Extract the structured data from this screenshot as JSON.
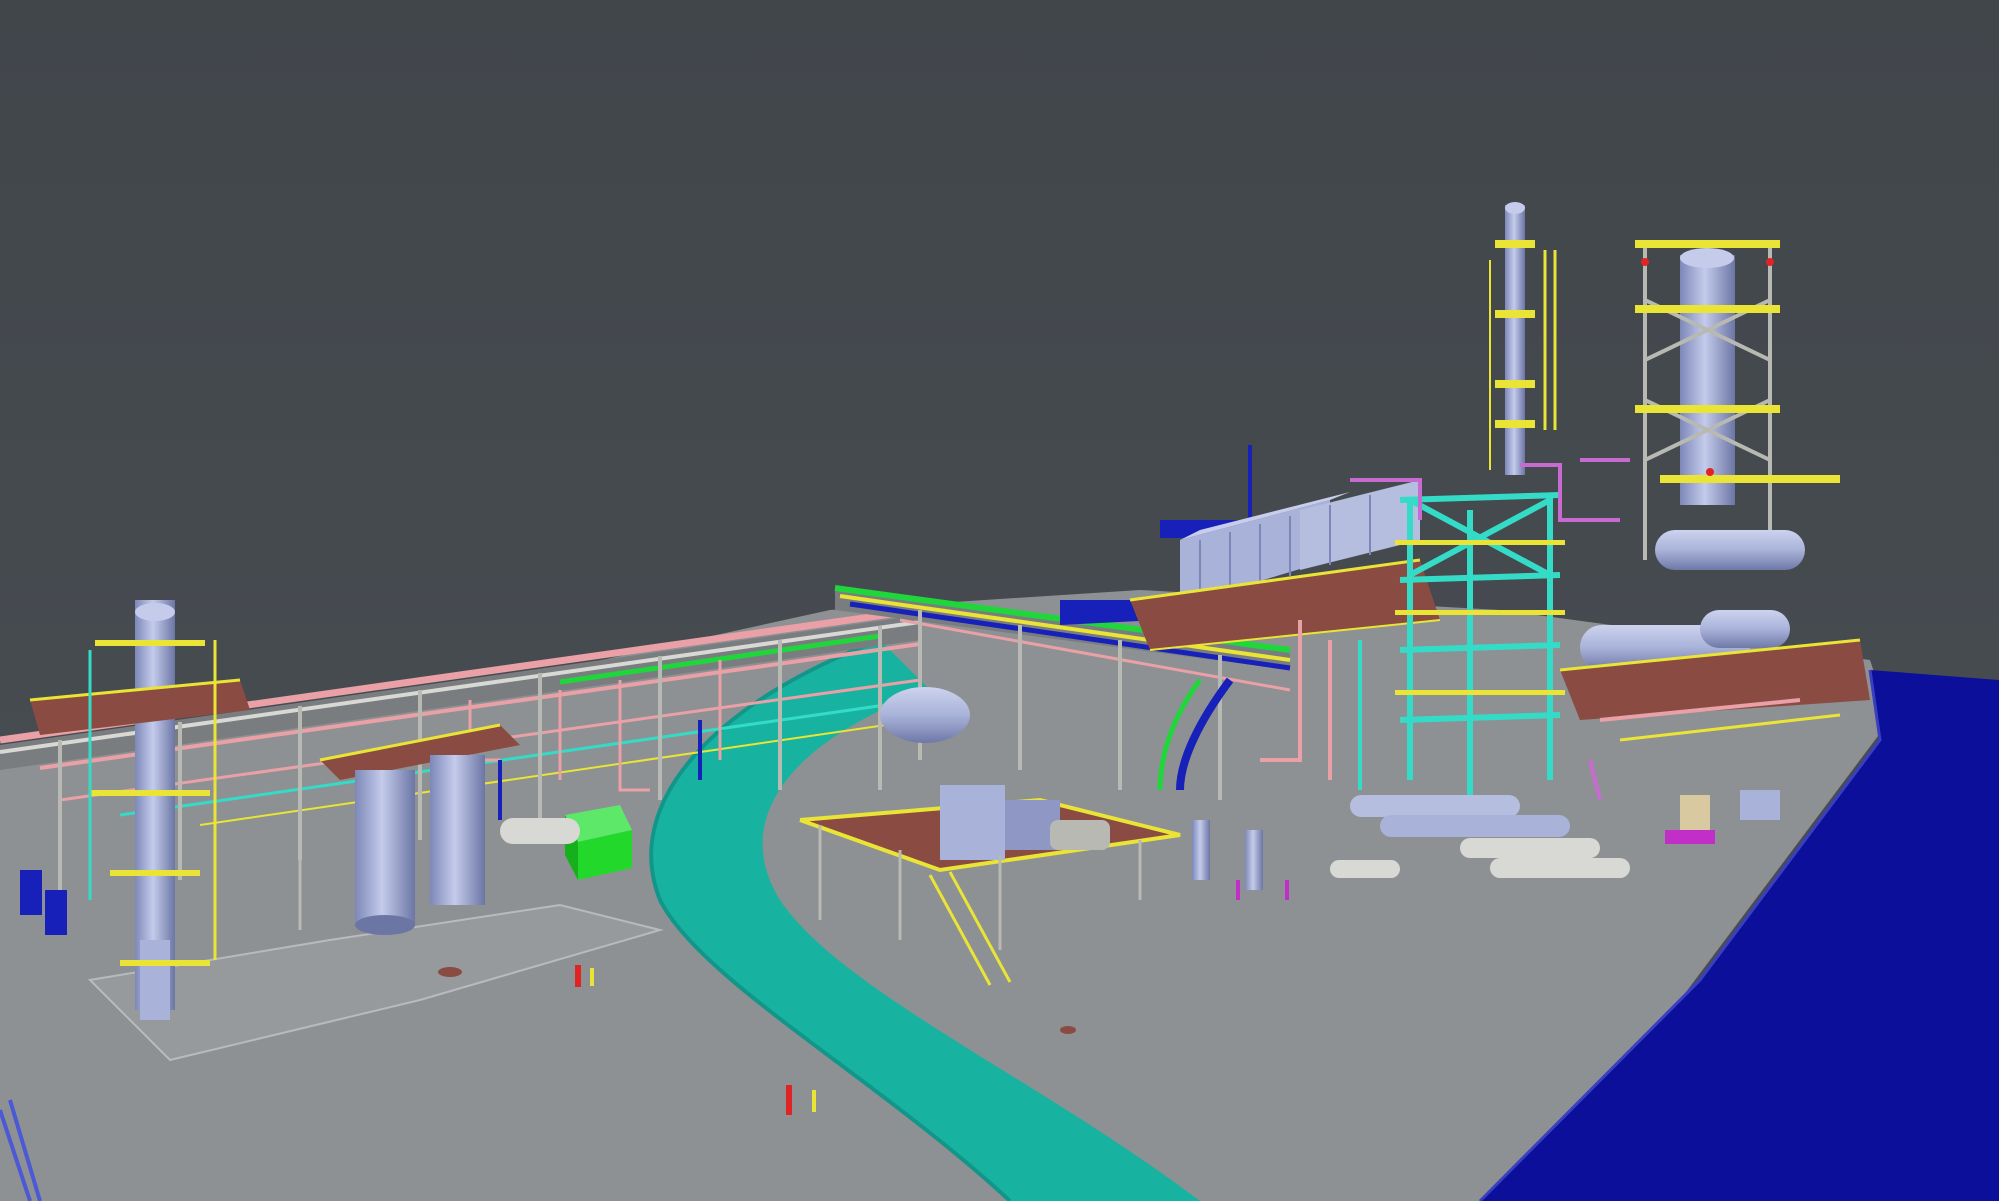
{
  "view": {
    "background_color": "#464b50",
    "ground_color": "#8e9193",
    "road_color": "#18b3a0",
    "water_color": "#0b0f9a"
  },
  "palette": {
    "vessel": "#a9b3d9",
    "vessel_shade": "#7d88b8",
    "handrail": "#e9e436",
    "steel": "#b9b9b3",
    "deck": "#8a4b42",
    "pipe_cyan": "#34dcc7",
    "pipe_pink": "#e9a0a6",
    "pipe_magenta": "#c86bd0",
    "pipe_blue": "#1720b8",
    "pipe_green": "#1fd63b",
    "pipe_white": "#d8d8d4",
    "enclosure_green": "#22d92b",
    "hydrant_red": "#e02424",
    "skid_magenta": "#c22ec8"
  }
}
